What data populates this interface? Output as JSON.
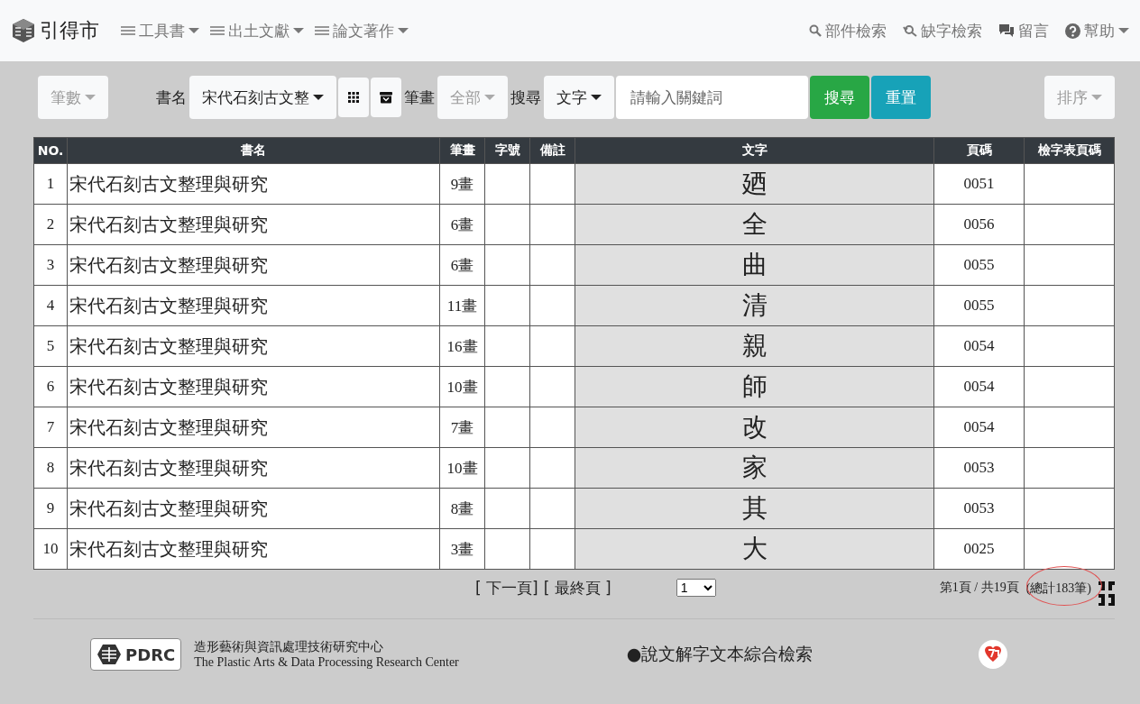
{
  "navbar": {
    "brand": "引得市",
    "menus": [
      {
        "label": "工具書",
        "has_caret": true
      },
      {
        "label": "出土文獻",
        "has_caret": true
      },
      {
        "label": "論文著作",
        "has_caret": true
      }
    ],
    "right_links": [
      {
        "kind": "search",
        "label": "部件檢索",
        "has_caret": false
      },
      {
        "kind": "lost",
        "label": "缺字檢索",
        "has_caret": false
      },
      {
        "kind": "comment",
        "label": "留言",
        "has_caret": false
      },
      {
        "kind": "help",
        "label": "幫助",
        "has_caret": true
      }
    ]
  },
  "toolbar": {
    "count_dropdown": {
      "label": "筆數",
      "disabled": true
    },
    "book_label": "書名",
    "book_dropdown": {
      "label": "宋代石刻古文整",
      "disabled": false
    },
    "strokes_label": "筆畫",
    "strokes_dropdown": {
      "label": "全部",
      "disabled": true
    },
    "search_label": "搜尋",
    "field_dropdown": {
      "label": "文字",
      "disabled": false
    },
    "search": {
      "placeholder": "請輸入關鍵詞"
    },
    "search_button": "搜尋",
    "reset_button": "重置",
    "sort_dropdown": {
      "label": "排序",
      "disabled": true
    }
  },
  "table": {
    "columns": [
      "NO.",
      "書名",
      "筆畫",
      "字號",
      "備註",
      "文字",
      "頁碼",
      "檢字表頁碼"
    ],
    "rows": [
      {
        "no": "1",
        "book": "宋代石刻古文整理與研究",
        "strokes": "9畫",
        "char": "廼",
        "page": "0051"
      },
      {
        "no": "2",
        "book": "宋代石刻古文整理與研究",
        "strokes": "6畫",
        "char": "全",
        "page": "0056"
      },
      {
        "no": "3",
        "book": "宋代石刻古文整理與研究",
        "strokes": "6畫",
        "char": "曲",
        "page": "0055"
      },
      {
        "no": "4",
        "book": "宋代石刻古文整理與研究",
        "strokes": "11畫",
        "char": "清",
        "page": "0055"
      },
      {
        "no": "5",
        "book": "宋代石刻古文整理與研究",
        "strokes": "16畫",
        "char": "親",
        "page": "0054"
      },
      {
        "no": "6",
        "book": "宋代石刻古文整理與研究",
        "strokes": "10畫",
        "char": "師",
        "page": "0054"
      },
      {
        "no": "7",
        "book": "宋代石刻古文整理與研究",
        "strokes": "7畫",
        "char": "改",
        "page": "0054"
      },
      {
        "no": "8",
        "book": "宋代石刻古文整理與研究",
        "strokes": "10畫",
        "char": "家",
        "page": "0053"
      },
      {
        "no": "9",
        "book": "宋代石刻古文整理與研究",
        "strokes": "8畫",
        "char": "其",
        "page": "0053"
      },
      {
        "no": "10",
        "book": "宋代石刻古文整理與研究",
        "strokes": "3畫",
        "char": "大",
        "page": "0025"
      }
    ]
  },
  "pagination": {
    "links": [
      "[ 下一頁]",
      "[ 最終頁 ]"
    ],
    "page_select": "1",
    "page_info": "第1頁 / 共19頁",
    "total": "(總計183筆)",
    "annotation_circle": true
  },
  "footer": {
    "logo_text": "PDRC",
    "org_zh": "造形藝術與資訊處理技術研究中心",
    "org_en": "The Plastic Arts & Data Processing Research Center",
    "site_name": "●說文解字文本綜合檢索"
  }
}
